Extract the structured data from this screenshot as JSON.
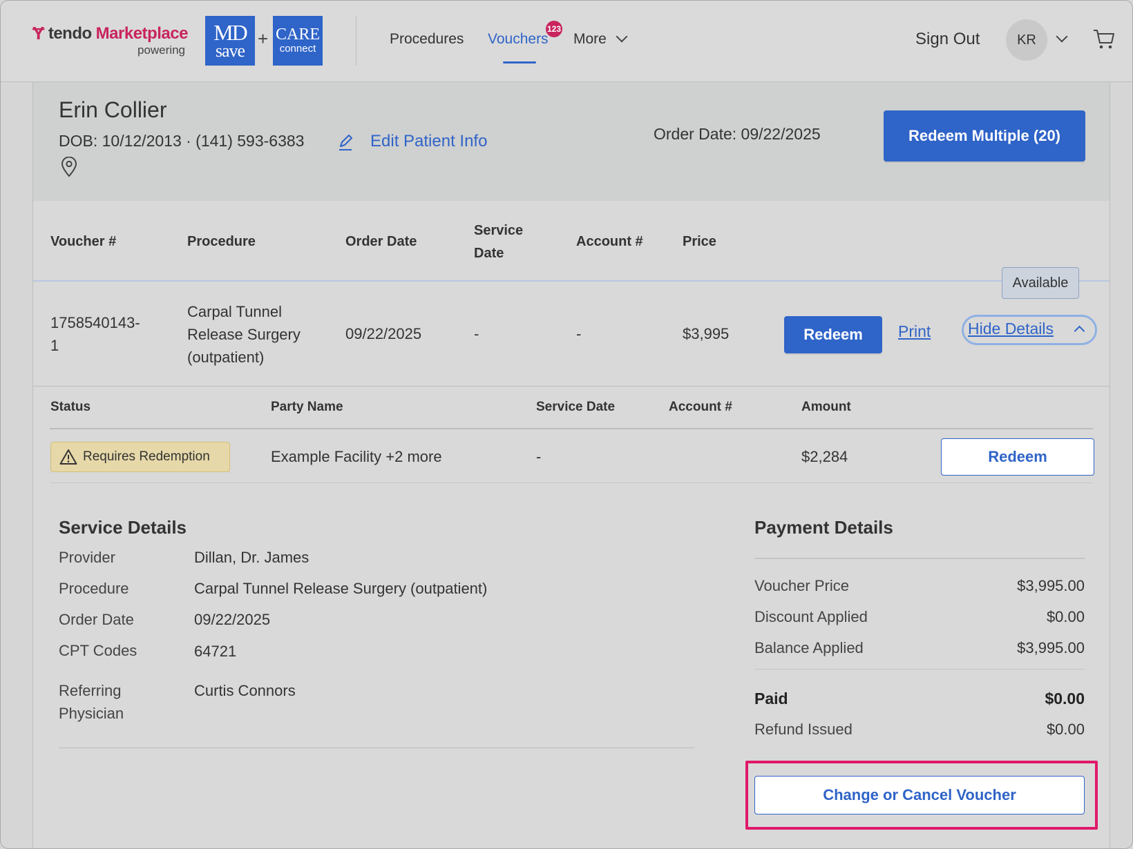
{
  "header": {
    "brand": {
      "mark": "Ɏ",
      "tendo": "tendo",
      "marketplace": "Marketplace",
      "powering": "powering"
    },
    "logos": {
      "md_line1": "MD",
      "md_line2": "save",
      "plus": "+",
      "care_line1": "CARE",
      "care_line2": "connect"
    },
    "nav": {
      "procedures": "Procedures",
      "vouchers": "Vouchers",
      "vouchers_badge": "123",
      "more": "More"
    },
    "sign_out": "Sign Out",
    "avatar_initials": "KR"
  },
  "patient": {
    "name": "Erin Collier",
    "meta": "DOB: 10/12/2013 · (141) 593-6383",
    "edit_link": "Edit Patient Info",
    "order_date": "Order Date: 09/22/2025",
    "redeem_multiple": "Redeem Multiple (20)"
  },
  "voucher_table": {
    "headers": {
      "voucher": "Voucher #",
      "procedure": "Procedure",
      "order_date": "Order Date",
      "service_date_line1": "Service",
      "service_date_line2": "Date",
      "account": "Account #",
      "price": "Price"
    },
    "row": {
      "voucher_line1": "1758540143-",
      "voucher_line2": "1",
      "procedure_line1": "Carpal Tunnel",
      "procedure_line2": "Release Surgery",
      "procedure_line3": "(outpatient)",
      "order_date": "09/22/2025",
      "service_date": "-",
      "account": "-",
      "price": "$3,995",
      "status_badge": "Available",
      "redeem": "Redeem",
      "print": "Print",
      "hide_details": "Hide Details"
    }
  },
  "sub_table": {
    "headers": {
      "status": "Status",
      "party": "Party Name",
      "service_date": "Service Date",
      "account": "Account #",
      "amount": "Amount"
    },
    "row": {
      "status": "Requires Redemption",
      "party": "Example Facility +2 more",
      "service_date": "-",
      "amount": "$2,284",
      "redeem": "Redeem"
    }
  },
  "service_details": {
    "title": "Service Details",
    "provider_label": "Provider",
    "provider": "Dillan, Dr. James",
    "procedure_label": "Procedure",
    "procedure": "Carpal Tunnel Release Surgery (outpatient)",
    "order_date_label": "Order Date",
    "order_date": "09/22/2025",
    "cpt_label": "CPT Codes",
    "cpt": "64721",
    "referring_label_line1": "Referring",
    "referring_label_line2": "Physician",
    "referring": "Curtis Connors"
  },
  "payment_details": {
    "title": "Payment Details",
    "voucher_price_label": "Voucher Price",
    "voucher_price": "$3,995.00",
    "discount_label": "Discount Applied",
    "discount": "$0.00",
    "balance_label": "Balance Applied",
    "balance": "$3,995.00",
    "paid_label": "Paid",
    "paid": "$0.00",
    "refund_label": "Refund Issued",
    "refund": "$0.00",
    "change_cancel": "Change or Cancel Voucher"
  },
  "colors": {
    "accent": "#2f64c8",
    "brand_pink": "#c8245e",
    "highlight": "#e0196a",
    "warning_bg": "#e6d8a8"
  }
}
